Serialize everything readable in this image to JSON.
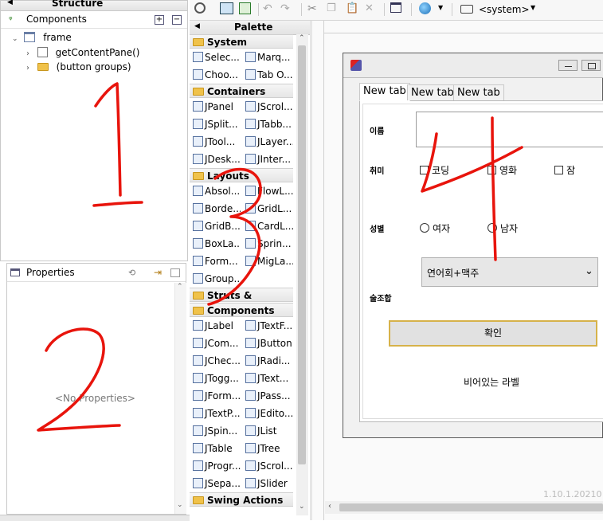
{
  "structure": {
    "title": "Structure",
    "components_label": "Components",
    "tree": [
      {
        "label": "frame"
      },
      {
        "label": "getContentPane()"
      },
      {
        "label": "(button groups)"
      }
    ]
  },
  "properties": {
    "title": "Properties",
    "empty_text": "<No Properties>"
  },
  "palette": {
    "title": "Palette",
    "categories": {
      "system": "System",
      "containers": "Containers",
      "layouts": "Layouts",
      "struts": "Struts & Springs",
      "components": "Components",
      "swing_actions": "Swing Actions"
    },
    "system_items": [
      "Selec...",
      "Marq...",
      "Choo...",
      "Tab O..."
    ],
    "container_items": [
      "JPanel",
      "JScrol...",
      "JSplit...",
      "JTabb...",
      "JTool...",
      "JLayer...",
      "JDesk...",
      "JInter..."
    ],
    "layout_items": [
      "Absol...",
      "FlowL...",
      "Borde...",
      "GridL...",
      "GridB...",
      "CardL...",
      "BoxLa...",
      "Sprin...",
      "Form...",
      "MigLa...",
      "Group..."
    ],
    "component_items": [
      "JLabel",
      "JTextF...",
      "JCom...",
      "JButton",
      "JChec...",
      "JRadi...",
      "JTogg...",
      "JText...",
      "JForm...",
      "JPass...",
      "JTextP...",
      "JEdito...",
      "JSpin...",
      "JList",
      "JTable",
      "JTree",
      "JProgr...",
      "JScrol...",
      "JSepa...",
      "JSlider"
    ]
  },
  "toolbar": {
    "lookandfeel_label": "<system>"
  },
  "form": {
    "tabs": [
      "New tab",
      "New tab",
      "New tab"
    ],
    "name_label": "이름",
    "hobby_label": "취미",
    "hobbies": [
      "코딩",
      "영화",
      "잠"
    ],
    "gender_label": "성별",
    "genders": [
      "여자",
      "남자"
    ],
    "drink_label": "술조합",
    "drink_selected": "연어회+맥주",
    "confirm_button": "확인",
    "result_label": "비어있는 라벨"
  },
  "version_text": "1.10.1.20210",
  "annotations": [
    "1",
    "2",
    "3",
    "4"
  ]
}
